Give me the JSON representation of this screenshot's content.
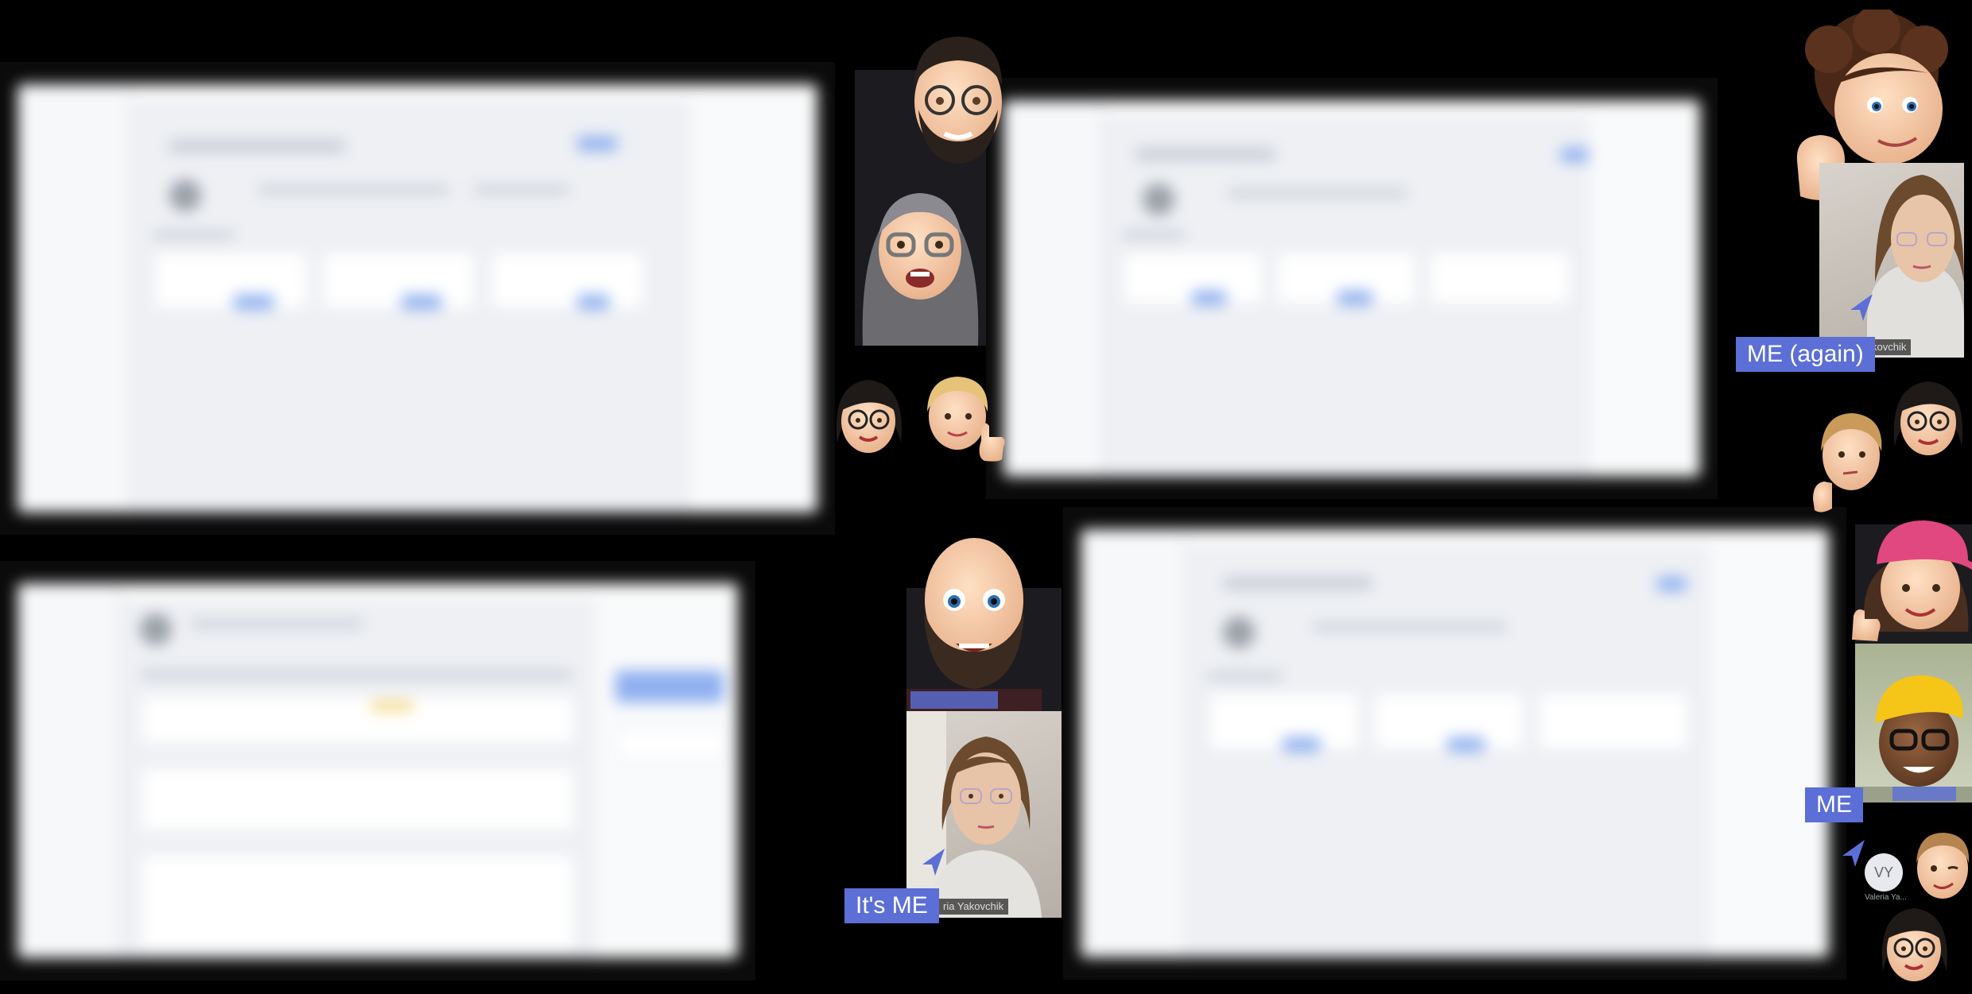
{
  "screens": [
    {
      "id": "screen-top-left"
    },
    {
      "id": "screen-top-middle"
    },
    {
      "id": "screen-bottom-left"
    },
    {
      "id": "screen-bottom-right"
    }
  ],
  "participants": {
    "memoji": [
      "memoji-bearded-glasses-man",
      "memoji-grey-haired-glasses-woman",
      "memoji-dark-haired-glasses-woman",
      "memoji-blonde-thumbs-up-woman",
      "memoji-bald-bearded-man",
      "memoji-curly-haired-man",
      "memoji-thinking-blonde-woman",
      "memoji-dark-haired-glasses-woman-2",
      "memoji-pink-cap-woman",
      "memoji-yellow-cap-man",
      "memoji-winking-man",
      "memoji-dark-haired-glasses-woman-3"
    ],
    "camera": {
      "main_name_fragment": "ria Yakovchik",
      "top_right_name_fragment": "kovchik"
    }
  },
  "labels": {
    "its_me": "It's ME",
    "me_again": "ME (again)",
    "me": "ME"
  },
  "vy_badge": {
    "initials": "VY",
    "name": "Valeria Ya..."
  },
  "colors": {
    "label_background": "#5b6fd6",
    "cursor": "#5b6fd6",
    "background": "#000000"
  }
}
